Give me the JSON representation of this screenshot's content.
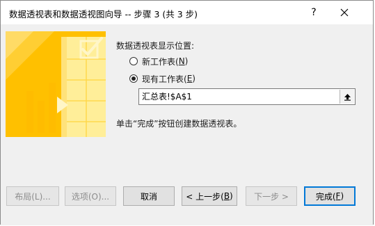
{
  "window": {
    "title": "数据透视表和数据透视图向导 -- 步骤 3 (共 3 步)",
    "help": "?",
    "close_icon": "close-icon"
  },
  "illustration": {
    "icon": "pivot-wizard-illustration",
    "colors": {
      "background": "#FFC000",
      "light": "#FFE066",
      "pale": "#FFF1A8"
    }
  },
  "location": {
    "heading": "数据透视表显示位置:",
    "new_sheet": {
      "label": "新工作表(",
      "hotkey": "N",
      "suffix": ")",
      "checked": false
    },
    "existing_sheet": {
      "label": "现有工作表(",
      "hotkey": "E",
      "suffix": ")",
      "checked": true
    },
    "reference_value": "汇总表!$A$1",
    "collapse_icon": "collapse-dialog-icon"
  },
  "hint": "单击“完成”按钮创建数据透视表。",
  "buttons": {
    "layout": "布局(L)...",
    "options": "选项(O)...",
    "cancel": "取消",
    "back_label": "< 上一步(",
    "back_hotkey": "B",
    "back_suffix": ")",
    "next": "下一步 >",
    "finish_label": "完成(",
    "finish_hotkey": "F",
    "finish_suffix": ")"
  },
  "colors": {
    "accent": "#0078D7"
  }
}
